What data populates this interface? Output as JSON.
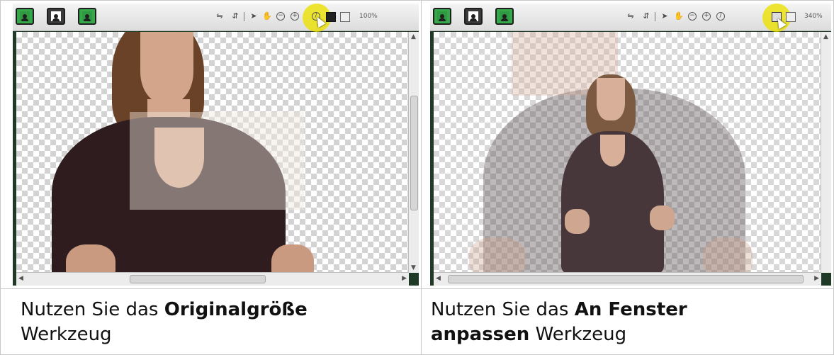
{
  "left_panel": {
    "zoom": "100%",
    "caption_prefix": "Nutzen Sie das",
    "caption_bold": "Originalgröße",
    "caption_suffix": "Werkzeug",
    "highlighted_tool": "original-size"
  },
  "right_panel": {
    "zoom": "340%",
    "caption_prefix": "Nutzen Sie das",
    "caption_bold": "An Fenster anpassen",
    "caption_suffix": "Werkzeug",
    "highlighted_tool": "fit-to-window"
  },
  "colors": {
    "highlight": "#ebe100",
    "toolbar_green": "#35a84a",
    "figure_top": "#2f1c1f",
    "hair": "#6a4227"
  },
  "icons": [
    "media-icon-green",
    "media-icon-dark",
    "media-icon-green-active",
    "flip-horizontal-icon",
    "flip-vertical-icon",
    "pointer-icon",
    "hand-icon",
    "zoom-out-icon",
    "zoom-in-icon",
    "original-size-icon",
    "fit-to-window-icon",
    "settings-icon"
  ]
}
